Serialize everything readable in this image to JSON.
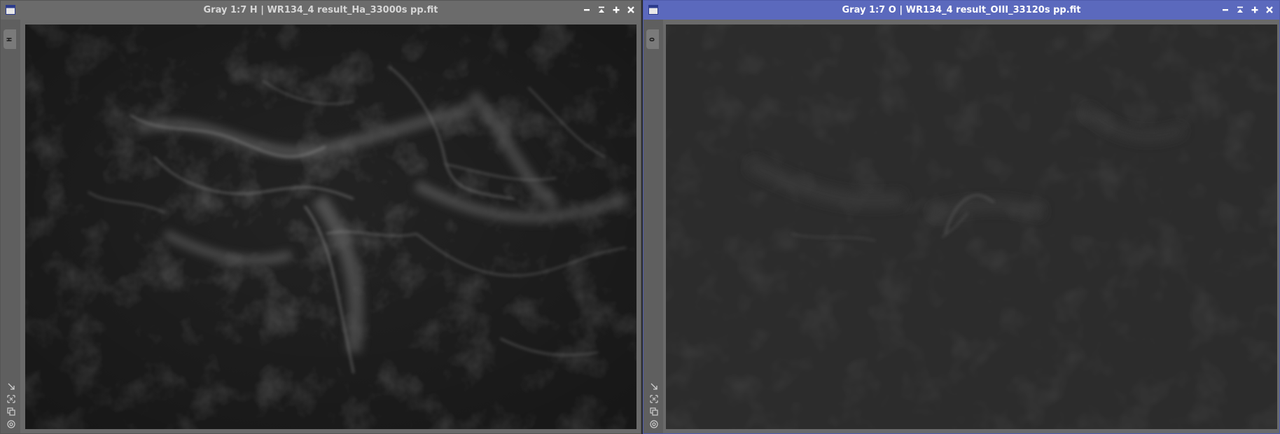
{
  "colors": {
    "inactive_titlebar": "#6b6b6b",
    "active_titlebar": "#5b69bd",
    "window_frame": "#6a6a6a",
    "ha_image_background": "#222222",
    "oiii_image_background": "#2b2b2b"
  },
  "windows": [
    {
      "title": "Gray 1:7 H | WR134_4 result_Ha_33000s pp.fit",
      "view_tab": "H",
      "active": false,
      "titlebar_icons": [
        "window-icon"
      ],
      "buttons": [
        "minimize-icon",
        "shade-icon",
        "maximize-icon",
        "close-icon"
      ],
      "side_tools": [
        "expand-icon",
        "fit-view-icon",
        "clone-icon",
        "target-icon"
      ]
    },
    {
      "title": "Gray 1:7 O | WR134_4 result_OIII_33120s pp.fit",
      "view_tab": "O",
      "active": true,
      "titlebar_icons": [
        "window-icon"
      ],
      "buttons": [
        "minimize-icon",
        "shade-icon",
        "maximize-icon",
        "close-icon"
      ],
      "side_tools": [
        "expand-icon",
        "fit-view-icon",
        "clone-icon",
        "target-icon"
      ]
    }
  ]
}
